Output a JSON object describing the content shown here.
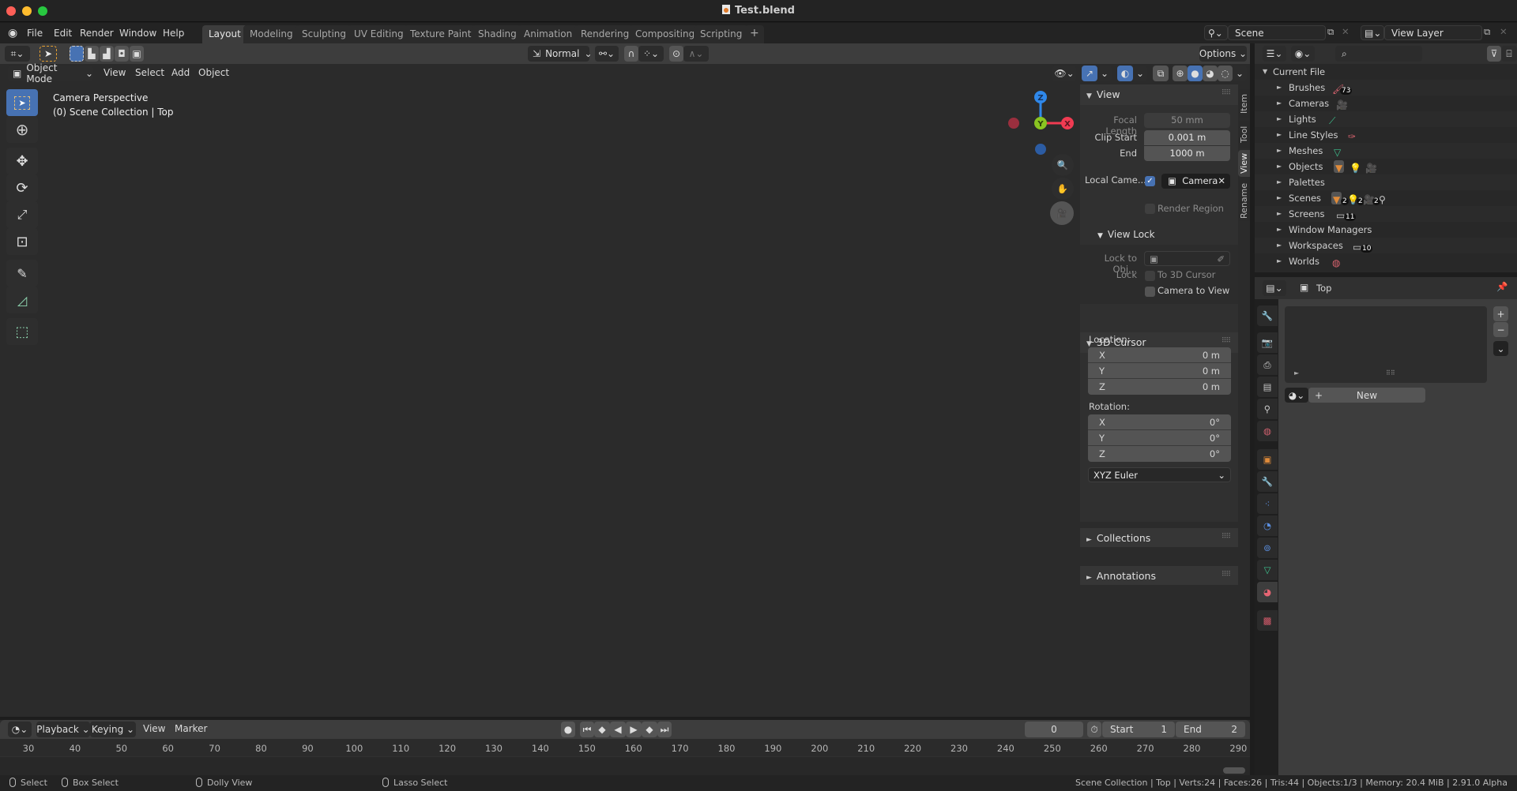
{
  "window": {
    "title": "Test.blend",
    "traffic_lights": {
      "close": "#fe5f57",
      "minimize": "#febc2e",
      "maximize": "#28c840"
    }
  },
  "topbar": {
    "menus": [
      "File",
      "Edit",
      "Render",
      "Window",
      "Help"
    ],
    "workspaces": [
      "Layout",
      "Modeling",
      "Sculpting",
      "UV Editing",
      "Texture Paint",
      "Shading",
      "Animation",
      "Rendering",
      "Compositing",
      "Scripting"
    ],
    "active_workspace": "Layout",
    "add_workspace": "+",
    "scene": "Scene",
    "view_layer": "View Layer"
  },
  "tool_header": {
    "transform_orientation": "Normal",
    "options_label": "Options"
  },
  "viewport": {
    "mode": "Object Mode",
    "menus": [
      "View",
      "Select",
      "Add",
      "Object"
    ],
    "info_line1": "Camera Perspective",
    "info_line2": "(0) Scene Collection | Top",
    "gizmo": {
      "z": "Z",
      "y": "Y",
      "x": "X",
      "colors": {
        "x": "#f03b52",
        "y": "#8ac421",
        "z": "#2f88ea"
      }
    },
    "tools": [
      "select-box",
      "cursor",
      "move",
      "rotate",
      "scale",
      "transform",
      "annotate",
      "measure",
      "add-cube"
    ]
  },
  "npanel": {
    "tabs": [
      "Item",
      "Tool",
      "View",
      "Rename"
    ],
    "active_tab": "View",
    "view": {
      "title": "View",
      "focal_length_label": "Focal Length",
      "focal_length": "50 mm",
      "clip_start_label": "Clip Start",
      "clip_start": "0.001 m",
      "clip_end_label": "End",
      "clip_end": "1000 m",
      "local_camera_label": "Local Came...",
      "local_camera_checked": true,
      "local_camera": "Camera",
      "render_region_label": "Render Region",
      "view_lock_title": "View Lock",
      "lock_to_obj_label": "Lock to Obj...",
      "lock_label": "Lock",
      "to_3d_cursor_label": "To 3D Cursor",
      "camera_to_view_label": "Camera to View"
    },
    "cursor": {
      "title": "3D Cursor",
      "location_label": "Location:",
      "location": [
        {
          "axis": "X",
          "value": "0 m"
        },
        {
          "axis": "Y",
          "value": "0 m"
        },
        {
          "axis": "Z",
          "value": "0 m"
        }
      ],
      "rotation_label": "Rotation:",
      "rotation": [
        {
          "axis": "X",
          "value": "0°"
        },
        {
          "axis": "Y",
          "value": "0°"
        },
        {
          "axis": "Z",
          "value": "0°"
        }
      ],
      "rotation_mode": "XYZ Euler"
    },
    "collections_title": "Collections",
    "annotations_title": "Annotations"
  },
  "outliner": {
    "root": "Current File",
    "items": [
      {
        "label": "Brushes",
        "badge": "73"
      },
      {
        "label": "Cameras"
      },
      {
        "label": "Lights"
      },
      {
        "label": "Line Styles"
      },
      {
        "label": "Meshes"
      },
      {
        "label": "Objects"
      },
      {
        "label": "Palettes"
      },
      {
        "label": "Scenes",
        "badges": [
          "2",
          "2",
          "2"
        ]
      },
      {
        "label": "Screens",
        "badge": "11"
      },
      {
        "label": "Window Managers"
      },
      {
        "label": "Workspaces",
        "badge": "10"
      },
      {
        "label": "Worlds"
      }
    ]
  },
  "properties": {
    "context": "Top",
    "new_label": "New",
    "tabs": [
      "tool",
      "render",
      "output",
      "view-layer",
      "scene",
      "world",
      "object",
      "modifiers",
      "particles",
      "physics",
      "constraints",
      "data",
      "material",
      "texture"
    ],
    "active_tab": "material"
  },
  "timeline": {
    "menus": [
      "Playback",
      "Keying",
      "View",
      "Marker"
    ],
    "current_frame": "0",
    "start_label": "Start",
    "start": "1",
    "end_label": "End",
    "end": "2",
    "ticks": [
      "30",
      "40",
      "50",
      "60",
      "70",
      "80",
      "90",
      "100",
      "110",
      "120",
      "130",
      "140",
      "150",
      "160",
      "170",
      "180",
      "190",
      "200",
      "210",
      "220",
      "230",
      "240",
      "250",
      "260",
      "270",
      "280",
      "290"
    ]
  },
  "statusbar": {
    "select": "Select",
    "box_select": "Box Select",
    "dolly_view": "Dolly View",
    "lasso_select": "Lasso Select",
    "stats": "Scene Collection | Top | Verts:24 | Faces:26 | Tris:44 | Objects:1/3 | Memory: 20.4 MiB | 2.91.0 Alpha"
  }
}
